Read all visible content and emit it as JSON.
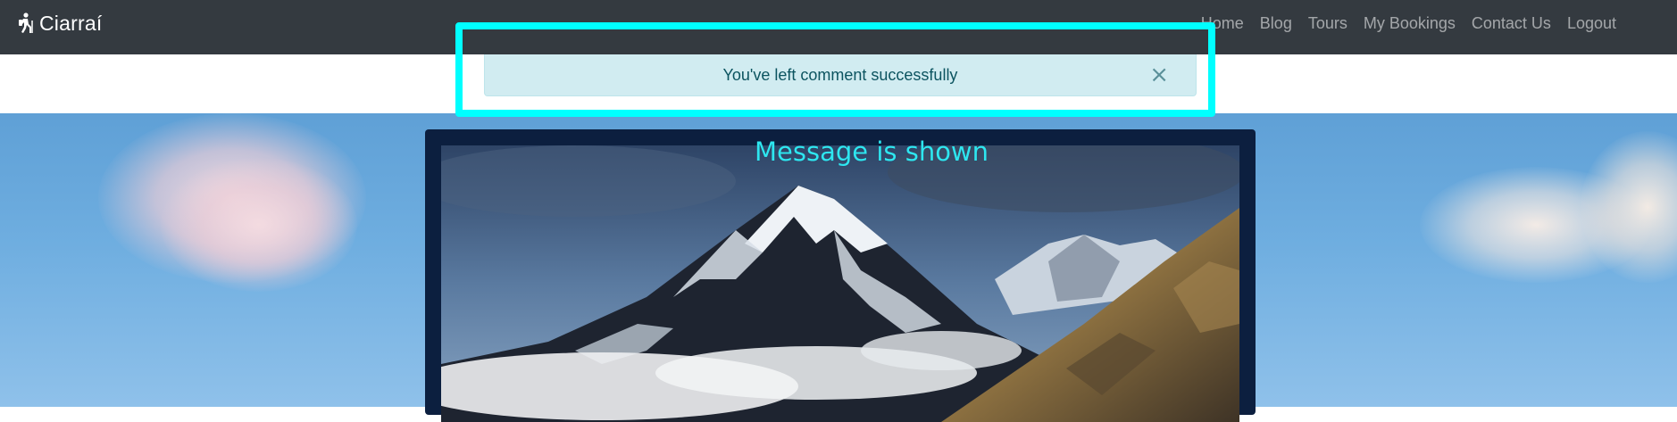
{
  "navbar": {
    "brand": {
      "name": "Ciarraí",
      "icon": "hiker-icon"
    },
    "links": [
      {
        "label": "Home"
      },
      {
        "label": "Blog"
      },
      {
        "label": "Tours"
      },
      {
        "label": "My Bookings"
      },
      {
        "label": "Contact Us"
      },
      {
        "label": "Logout"
      }
    ]
  },
  "alert": {
    "message": "You've left comment successfully",
    "close_symbol": "×",
    "colors": {
      "background": "#d1ecf1",
      "text": "#0c5460"
    }
  },
  "annotation": {
    "caption": "Message is shown",
    "color": "#00ffff"
  },
  "hero": {
    "photo_subject": "snow-capped mountain",
    "card_color": "#0c1f3f"
  }
}
